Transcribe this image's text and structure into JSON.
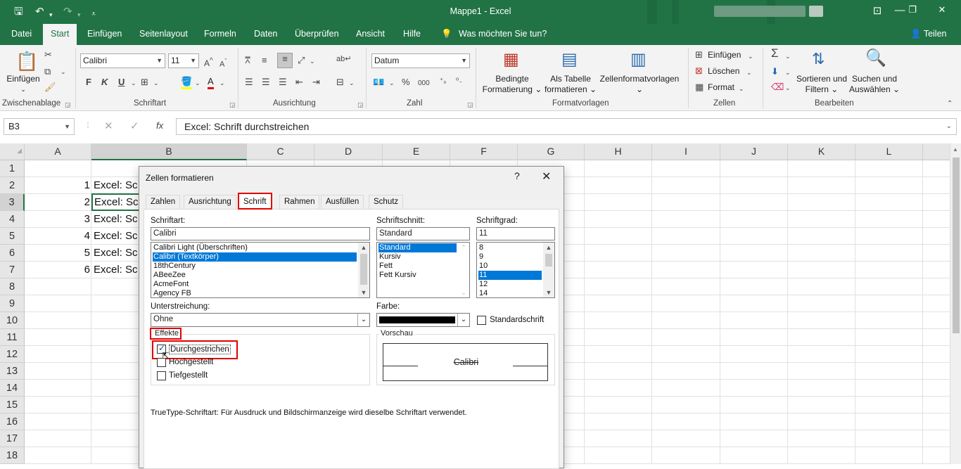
{
  "titlebar": {
    "title": "Mappe1  -  Excel",
    "minimize": "—",
    "restore": "❐",
    "close": "✕"
  },
  "tabs": [
    "Datei",
    "Start",
    "Einfügen",
    "Seitenlayout",
    "Formeln",
    "Daten",
    "Überprüfen",
    "Ansicht",
    "Hilfe"
  ],
  "tell_me": "Was möchten Sie tun?",
  "share": "Teilen",
  "ribbon": {
    "paste": "Einfügen",
    "clipboard": "Zwischenablage",
    "font_name": "Calibri",
    "font_size": "11",
    "bold": "F",
    "italic": "K",
    "underline": "U",
    "font_group": "Schriftart",
    "align_group": "Ausrichtung",
    "number_format": "Datum",
    "number_group": "Zahl",
    "percent": "%",
    "thousands": "000",
    "cond_format_1": "Bedingte",
    "cond_format_2": "Formatierung",
    "as_table_1": "Als Tabelle",
    "as_table_2": "formatieren",
    "cell_styles": "Zellenformatvorlagen",
    "styles_group": "Formatvorlagen",
    "insert": "Einfügen",
    "delete": "Löschen",
    "format": "Format",
    "cells_group": "Zellen",
    "sort_1": "Sortieren und",
    "sort_2": "Filtern",
    "find_1": "Suchen und",
    "find_2": "Auswählen",
    "edit_group": "Bearbeiten"
  },
  "formula_bar": {
    "name_box": "B3",
    "formula": "Excel: Schrift durchstreichen",
    "fx": "fx"
  },
  "columns": [
    "A",
    "B",
    "C",
    "D",
    "E",
    "F",
    "G",
    "H",
    "I",
    "J",
    "K",
    "L"
  ],
  "rows": [
    "1",
    "2",
    "3",
    "4",
    "5",
    "6",
    "7",
    "8",
    "9",
    "10",
    "11",
    "12",
    "13",
    "14",
    "15",
    "16",
    "17",
    "18"
  ],
  "cells": {
    "a": [
      "1",
      "2",
      "3",
      "4",
      "5",
      "6"
    ],
    "b": [
      "Excel: Sc",
      "Excel: Sc",
      "Excel: Sc",
      "Excel: Sc",
      "Excel: Sc",
      "Excel: Sc"
    ]
  },
  "dialog": {
    "title": "Zellen formatieren",
    "help": "?",
    "close": "✕",
    "tabs": [
      "Zahlen",
      "Ausrichtung",
      "Schrift",
      "Rahmen",
      "Ausfüllen",
      "Schutz"
    ],
    "font_label": "Schriftart:",
    "font_value": "Calibri",
    "font_list": [
      "Calibri Light (Überschriften)",
      "Calibri (Textkörper)",
      "18thCentury",
      "ABeeZee",
      "AcmeFont",
      "Agency FB"
    ],
    "style_label": "Schriftschnitt:",
    "style_value": "Standard",
    "style_list": [
      "Standard",
      "Kursiv",
      "Fett",
      "Fett Kursiv"
    ],
    "size_label": "Schriftgrad:",
    "size_value": "11",
    "size_list": [
      "8",
      "9",
      "10",
      "11",
      "12",
      "14"
    ],
    "underline_label": "Unterstreichung:",
    "underline_value": "Ohne",
    "color_label": "Farbe:",
    "color_value": "#000000",
    "default_font": "Standardschrift",
    "effects_label": "Effekte",
    "strikethrough": "Durchgestrichen",
    "superscript": "Hochgestellt",
    "subscript": "Tiefgestellt",
    "preview_label": "Vorschau",
    "preview_text": "Calibri",
    "info": "TrueType-Schriftart: Für Ausdruck und Bildschirmanzeige wird dieselbe Schriftart verwendet."
  }
}
